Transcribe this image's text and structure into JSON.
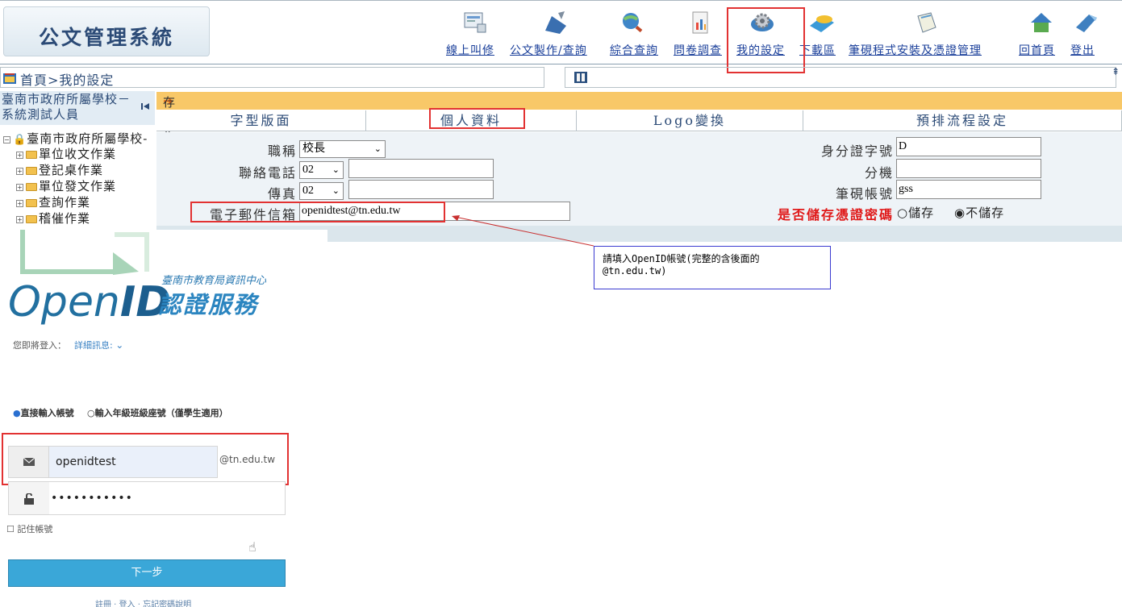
{
  "header": {
    "app_title": "公文管理系統",
    "nav": [
      {
        "label": "線上叫修",
        "icon": "monitor-icon"
      },
      {
        "label": "公文製作/查詢",
        "icon": "pen-icon"
      },
      {
        "label": "綜合查詢",
        "icon": "globe-search-icon"
      },
      {
        "label": "問卷調查",
        "icon": "chart-doc-icon"
      },
      {
        "label": "我的設定",
        "icon": "gear-icon"
      },
      {
        "label": "下載區",
        "icon": "cd-icon"
      },
      {
        "label": "筆硯程式安裝及憑證管理",
        "icon": "book-icon"
      },
      {
        "label": "回首頁",
        "icon": "home-icon"
      },
      {
        "label": "登出",
        "icon": "logout-icon"
      }
    ]
  },
  "breadcrumb": "首頁>我的設定",
  "sidebar": {
    "heading": "臺南市政府所屬學校－系統測試人員",
    "root": "臺南市政府所屬學校-",
    "items": [
      "單位收文作業",
      "登記桌作業",
      "單位發文作業",
      "查詢作業",
      "稽催作業"
    ]
  },
  "status": "存檔作業完成",
  "tabs": [
    "字型版面",
    "個人資料",
    "Logo變換",
    "預排流程設定"
  ],
  "form": {
    "title_label": "職稱",
    "title_value": "校長",
    "phone_label": "聯絡電話",
    "phone_area": "02",
    "phone_value": "",
    "fax_label": "傳真",
    "fax_area": "02",
    "fax_value": "",
    "email_label": "電子郵件信箱",
    "email_value": "openidtest@tn.edu.tw",
    "id_label": "身分證字號",
    "id_value": "D",
    "ext_label": "分機",
    "ext_value": "",
    "account_label": "筆硯帳號",
    "account_value": "gss",
    "save_pw_label": "是否儲存憑證密碼",
    "save_option": "儲存",
    "nosave_option": "不儲存",
    "save_pw_color": "#e01818"
  },
  "annotation": {
    "note": "請填入OpenID帳號(完整的含後面的@tn.edu.tw)",
    "highlight_color": "#e23232"
  },
  "openid": {
    "brand_word": "Open",
    "brand_id": "ID",
    "org": "臺南市教育局資訊中心",
    "service": "認證服務",
    "about_to_login": "您即將登入：",
    "details": "詳細訊息:",
    "mode_direct": "直接輸入帳號",
    "mode_grade": "輸入年級班級座號（僅學生適用）",
    "username": "openidtest",
    "domain_suffix": "@tn.edu.tw",
    "password_mask": "•••••••••••",
    "remember": "記住帳號",
    "next_button": "下一步",
    "footer_links": "註冊 · 登入 · 忘記密碼說明"
  }
}
